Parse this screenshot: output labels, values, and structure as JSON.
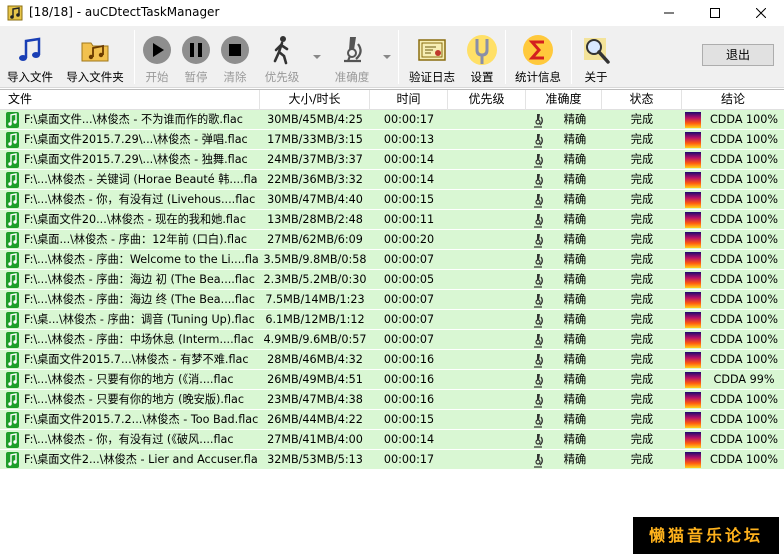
{
  "window": {
    "title": "[18/18] - auCDtectTaskManager"
  },
  "toolbar": {
    "import_file": "导入文件",
    "import_folder": "导入文件夹",
    "start": "开始",
    "pause": "暂停",
    "clear": "清除",
    "priority": "优先级",
    "accuracy": "准确度",
    "verify_log": "验证日志",
    "settings": "设置",
    "statistics": "统计信息",
    "about": "关于",
    "exit": "退出"
  },
  "columns": {
    "file": "文件",
    "size_duration": "大小/时长",
    "time": "时间",
    "priority": "优先级",
    "accuracy": "准确度",
    "status": "状态",
    "conclusion": "结论"
  },
  "rows": [
    {
      "file": "F:\\桌面文件...\\林俊杰 - 不为谁而作的歌.flac",
      "size": "30MB/45MB/4:25",
      "time": "00:00:17",
      "priority": "",
      "accuracy": "精确",
      "status": "完成",
      "conclusion": "CDDA 100%"
    },
    {
      "file": "F:\\桌面文件2015.7.29\\...\\林俊杰 - 弹唱.flac",
      "size": "17MB/33MB/3:15",
      "time": "00:00:13",
      "priority": "",
      "accuracy": "精确",
      "status": "完成",
      "conclusion": "CDDA 100%"
    },
    {
      "file": "F:\\桌面文件2015.7.29\\...\\林俊杰 - 独舞.flac",
      "size": "24MB/37MB/3:37",
      "time": "00:00:14",
      "priority": "",
      "accuracy": "精确",
      "status": "完成",
      "conclusion": "CDDA 100%"
    },
    {
      "file": "F:\\...\\林俊杰 - 关键词 (Horae Beauté 韩....flac",
      "size": "22MB/36MB/3:32",
      "time": "00:00:14",
      "priority": "",
      "accuracy": "精确",
      "status": "完成",
      "conclusion": "CDDA 100%"
    },
    {
      "file": "F:\\...\\林俊杰 - 你，有没有过 (Livehous....flac",
      "size": "30MB/47MB/4:40",
      "time": "00:00:15",
      "priority": "",
      "accuracy": "精确",
      "status": "完成",
      "conclusion": "CDDA 100%"
    },
    {
      "file": "F:\\桌面文件20...\\林俊杰 - 现在的我和她.flac",
      "size": "13MB/28MB/2:48",
      "time": "00:00:11",
      "priority": "",
      "accuracy": "精确",
      "status": "完成",
      "conclusion": "CDDA 100%"
    },
    {
      "file": "F:\\桌面...\\林俊杰 - 序曲：12年前 (口白).flac",
      "size": "27MB/62MB/6:09",
      "time": "00:00:20",
      "priority": "",
      "accuracy": "精确",
      "status": "完成",
      "conclusion": "CDDA 100%"
    },
    {
      "file": "F:\\...\\林俊杰 - 序曲：Welcome to the Li....flac",
      "size": "3.5MB/9.8MB/0:58",
      "time": "00:00:07",
      "priority": "",
      "accuracy": "精确",
      "status": "完成",
      "conclusion": "CDDA 100%"
    },
    {
      "file": "F:\\...\\林俊杰 - 序曲：海边 初 (The Bea....flac",
      "size": "2.3MB/5.2MB/0:30",
      "time": "00:00:05",
      "priority": "",
      "accuracy": "精确",
      "status": "完成",
      "conclusion": "CDDA 100%"
    },
    {
      "file": "F:\\...\\林俊杰 - 序曲：海边 终 (The Bea....flac",
      "size": "7.5MB/14MB/1:23",
      "time": "00:00:07",
      "priority": "",
      "accuracy": "精确",
      "status": "完成",
      "conclusion": "CDDA 100%"
    },
    {
      "file": "F:\\桌...\\林俊杰 - 序曲：调音 (Tuning Up).flac",
      "size": "6.1MB/12MB/1:12",
      "time": "00:00:07",
      "priority": "",
      "accuracy": "精确",
      "status": "完成",
      "conclusion": "CDDA 100%"
    },
    {
      "file": "F:\\...\\林俊杰 - 序曲：中场休息 (Interm....flac",
      "size": "4.9MB/9.6MB/0:57",
      "time": "00:00:07",
      "priority": "",
      "accuracy": "精确",
      "status": "完成",
      "conclusion": "CDDA 100%"
    },
    {
      "file": "F:\\桌面文件2015.7...\\林俊杰 - 有梦不难.flac",
      "size": "28MB/46MB/4:32",
      "time": "00:00:16",
      "priority": "",
      "accuracy": "精确",
      "status": "完成",
      "conclusion": "CDDA 100%"
    },
    {
      "file": "F:\\...\\林俊杰 - 只要有你的地方 (《消....flac",
      "size": "26MB/49MB/4:51",
      "time": "00:00:16",
      "priority": "",
      "accuracy": "精确",
      "status": "完成",
      "conclusion": "CDDA 99%"
    },
    {
      "file": "F:\\...\\林俊杰 - 只要有你的地方 (晚安版).flac",
      "size": "23MB/47MB/4:38",
      "time": "00:00:16",
      "priority": "",
      "accuracy": "精确",
      "status": "完成",
      "conclusion": "CDDA 100%"
    },
    {
      "file": "F:\\桌面文件2015.7.2...\\林俊杰 - Too Bad.flac",
      "size": "26MB/44MB/4:22",
      "time": "00:00:15",
      "priority": "",
      "accuracy": "精确",
      "status": "完成",
      "conclusion": "CDDA 100%"
    },
    {
      "file": "F:\\...\\林俊杰 - 你，有没有过 (《破风....flac",
      "size": "27MB/41MB/4:00",
      "time": "00:00:14",
      "priority": "",
      "accuracy": "精确",
      "status": "完成",
      "conclusion": "CDDA 100%"
    },
    {
      "file": "F:\\桌面文件2...\\林俊杰 - Lier and Accuser.flac",
      "size": "32MB/53MB/5:13",
      "time": "00:00:17",
      "priority": "",
      "accuracy": "精确",
      "status": "完成",
      "conclusion": "CDDA 100%"
    }
  ],
  "watermark": "懒猫音乐论坛",
  "colors": {
    "row_bg": "#d9f7d3",
    "accent": "#1a8f1a"
  }
}
